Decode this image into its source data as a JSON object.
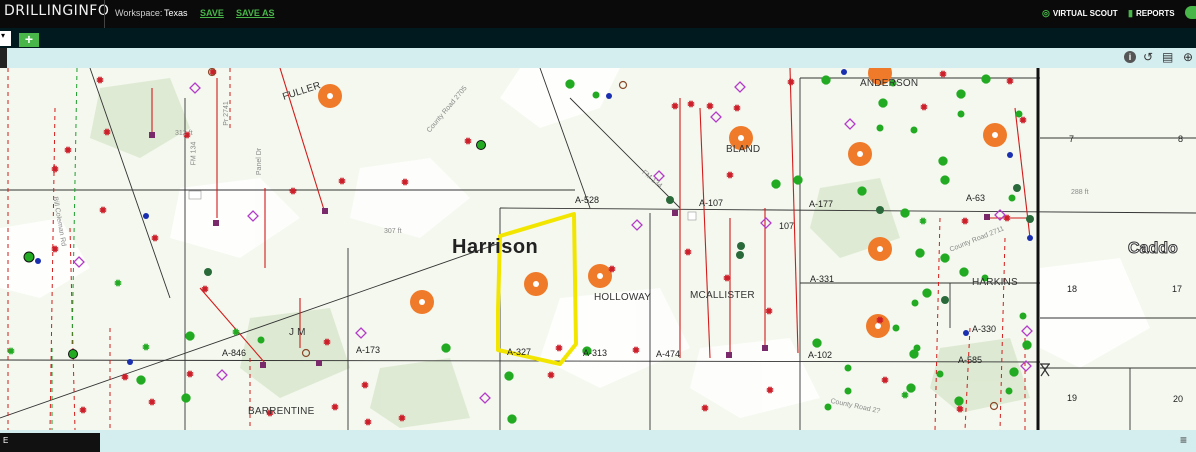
{
  "header": {
    "brand": "DRILLINGINFO",
    "workspace_label": "Workspace:",
    "workspace_name": "Texas",
    "save": "SAVE",
    "save_as": "SAVE AS",
    "virtual_scout": "VIRTUAL SCOUT",
    "reports": "REPORTS"
  },
  "tabs": {
    "active_tab_glyph": "▾",
    "add_tab": "+"
  },
  "map_toolbar": {
    "info": "i",
    "undo": "↺",
    "map_view": "▤",
    "zoom": "⊕"
  },
  "map": {
    "county_main": "Harrison",
    "county_east": "Caddo",
    "surveys": [
      "A-528",
      "A-107",
      "A-177",
      "A-63",
      "A-331",
      "A-330",
      "A-327",
      "A-313",
      "A-474",
      "A-102",
      "A-585",
      "A-173",
      "A-846",
      "107",
      "18",
      "19",
      "20",
      "7",
      "17",
      "8"
    ],
    "leases": [
      "FULLER",
      "ANDERSON",
      "BLAND",
      "HOLLOWAY",
      "MCALLISTER",
      "HARKINS",
      "J M",
      "BARRENTINE"
    ],
    "roads": [
      "County Road 2705",
      "Pr 2741",
      "FM 134",
      "Panel Dr",
      "Bill Coleman Rd",
      "County Road 2711",
      "FM 134",
      "County Road 2?",
      "288 ft",
      "307 ft",
      "312 ft"
    ],
    "selection_color": "#f2e600",
    "colors": {
      "permit_star": "#cc1f2a",
      "producing_well": "#22aa22",
      "gas_well": "#2a7a3a",
      "pad_large": "#ef7a2a",
      "permit_diamond": "#b43cc8",
      "lease_line": "#d41b1b",
      "county_line": "#222222",
      "survey_line": "#333333"
    }
  },
  "bottom": {
    "left_glyph": "E",
    "right_glyph": "≡"
  }
}
